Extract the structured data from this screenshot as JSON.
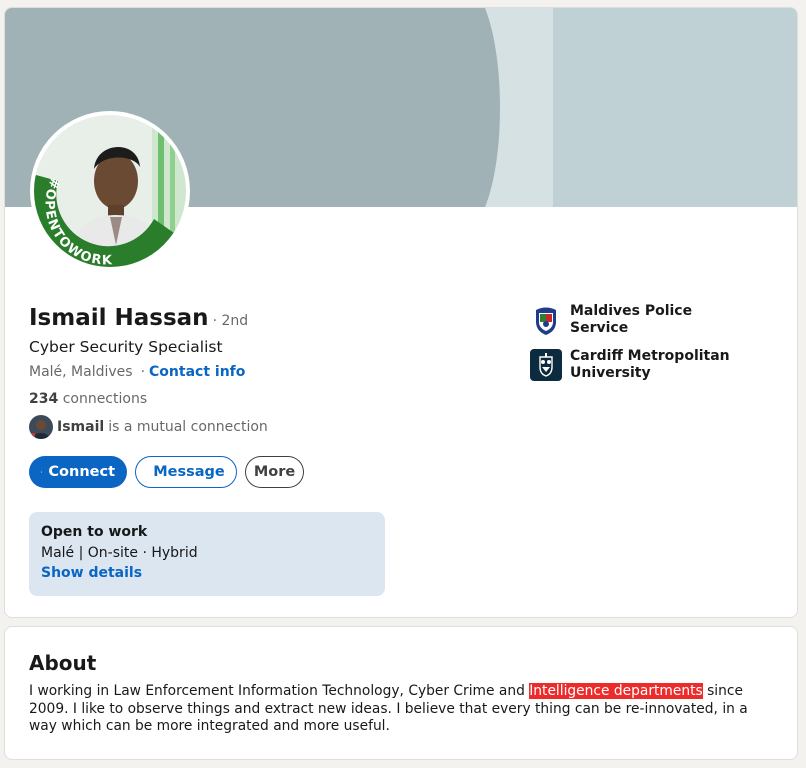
{
  "profile": {
    "name": "Ismail Hassan",
    "degree": "· 2nd",
    "headline": "Cyber Security Specialist",
    "location": "Malé, Maldives",
    "location_separator": "·",
    "contact_info": "Contact info",
    "connections_count": "234",
    "connections_label": "connections",
    "mutual_name": "Ismail",
    "mutual_text": "is a mutual connection",
    "avatar_frame_text": "#OPENTOWORK"
  },
  "actions": {
    "connect_label": "Connect",
    "message_label": "Message",
    "more_label": "More"
  },
  "open_to_work": {
    "title": "Open to work",
    "details": "Malé | On-site · Hybrid",
    "link": "Show details"
  },
  "organizations": [
    {
      "name": "Maldives Police Service",
      "icon": "police-logo"
    },
    {
      "name": "Cardiff Metropolitan University",
      "icon": "university-logo"
    }
  ],
  "about": {
    "title": "About",
    "text_before": "I working in Law Enforcement Information Technology, Cyber Crime and ",
    "text_highlight": "Intelligence departments",
    "text_after": " since 2009. I like to observe things and extract new ideas. I believe that every thing can be re-innovated, in a way which can be more integrated and more useful."
  },
  "colors": {
    "accent": "#0a66c2",
    "open_to_work_bg": "#dce6f1",
    "opentowork_green": "#2a7d2a",
    "highlight": "#ee2b2b"
  }
}
